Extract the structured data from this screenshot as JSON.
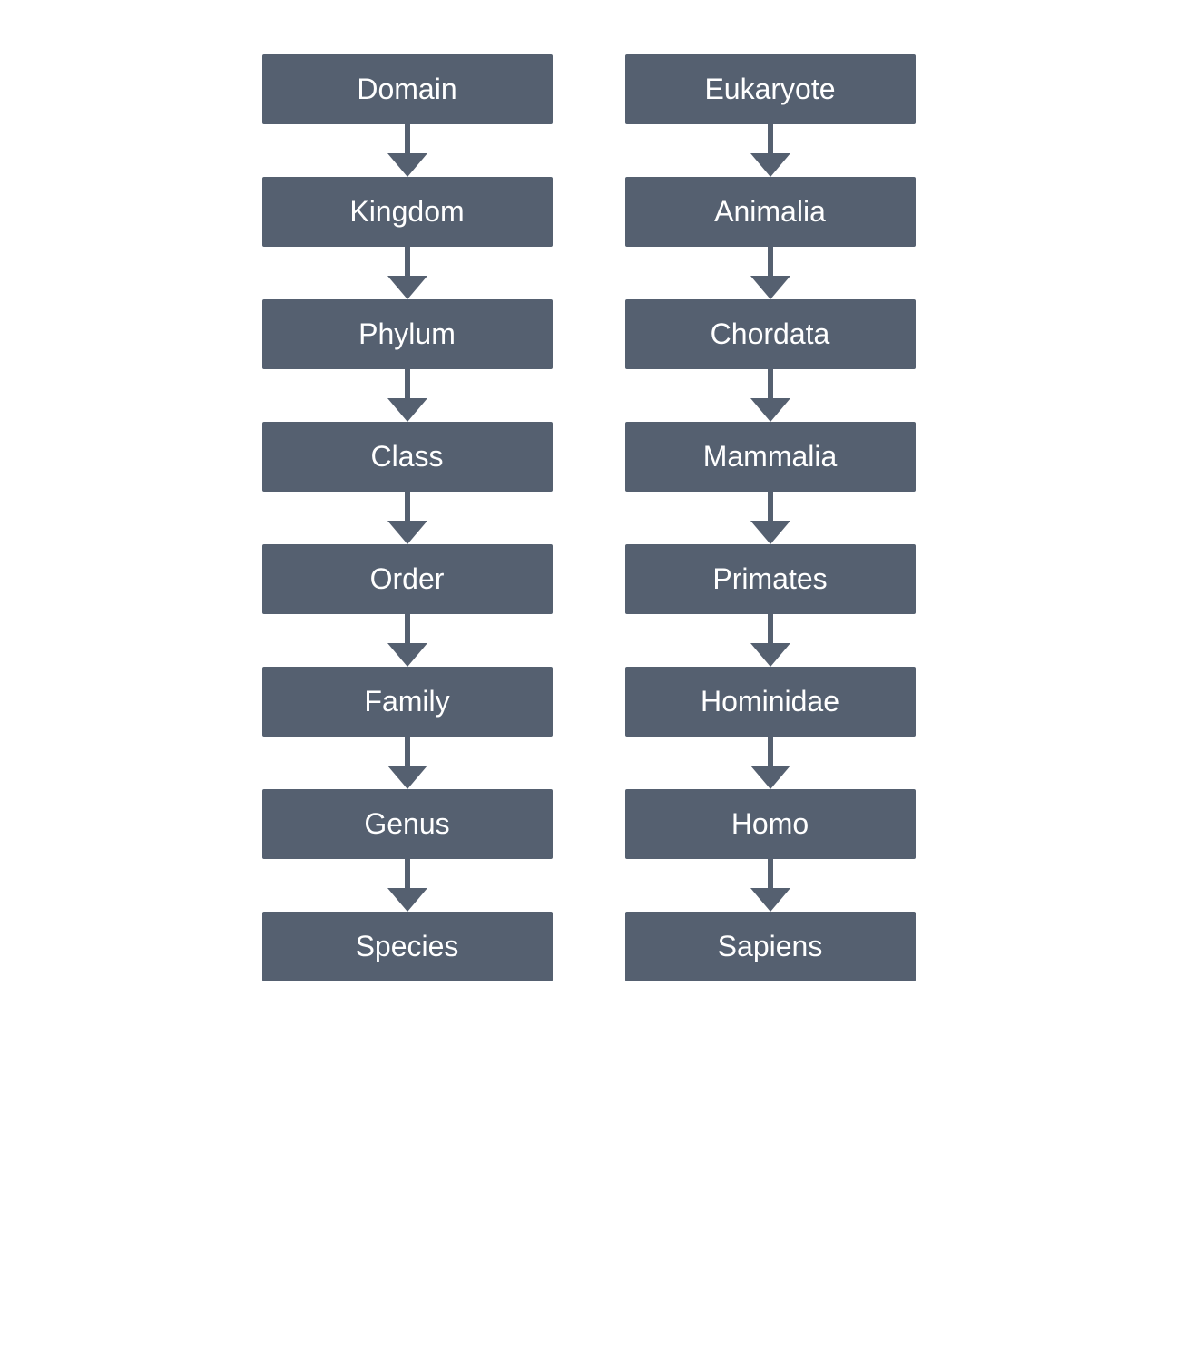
{
  "leftColumn": {
    "items": [
      {
        "label": "Domain"
      },
      {
        "label": "Kingdom"
      },
      {
        "label": "Phylum"
      },
      {
        "label": "Class"
      },
      {
        "label": "Order"
      },
      {
        "label": "Family"
      },
      {
        "label": "Genus"
      },
      {
        "label": "Species"
      }
    ]
  },
  "rightColumn": {
    "items": [
      {
        "label": "Eukaryote"
      },
      {
        "label": "Animalia"
      },
      {
        "label": "Chordata"
      },
      {
        "label": "Mammalia"
      },
      {
        "label": "Primates"
      },
      {
        "label": "Hominidae"
      },
      {
        "label": "Homo"
      },
      {
        "label": "Sapiens"
      }
    ]
  }
}
